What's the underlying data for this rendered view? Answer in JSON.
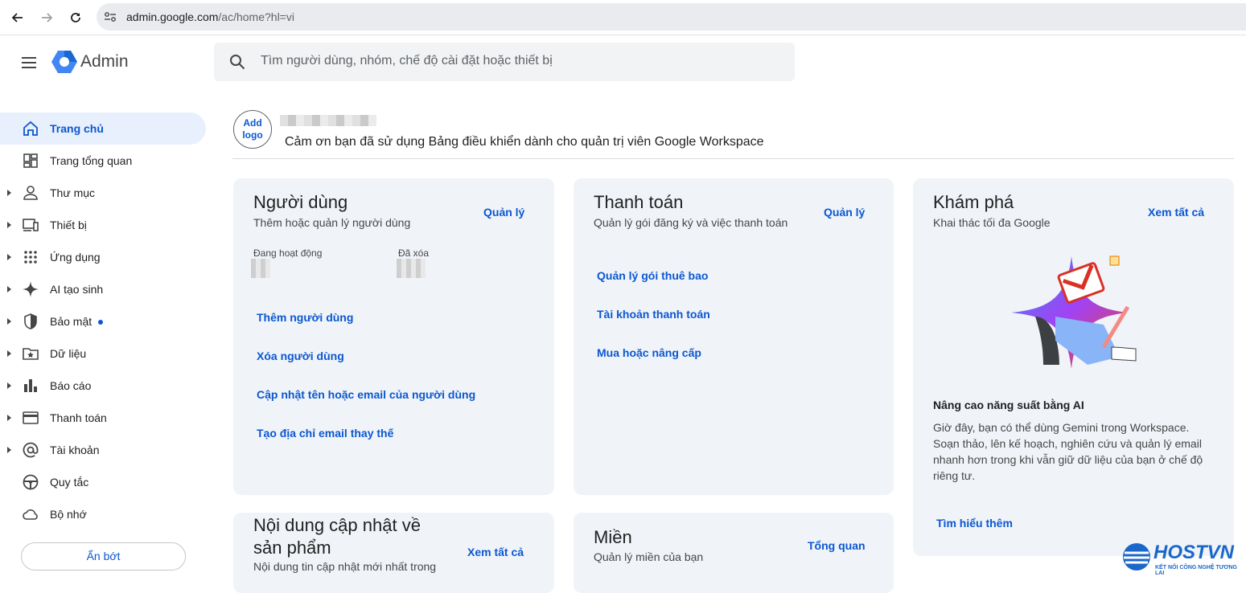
{
  "browser": {
    "url_host": "admin.google.com",
    "url_path": "/ac/home?hl=vi"
  },
  "header": {
    "brand": "Admin",
    "search_placeholder": "Tìm người dùng, nhóm, chế độ cài đặt hoặc thiết bị"
  },
  "sidebar": {
    "items": [
      {
        "label": "Trang chủ",
        "icon": "home-icon",
        "active": true,
        "caret": false
      },
      {
        "label": "Trang tổng quan",
        "icon": "dashboard-icon",
        "caret": false
      },
      {
        "label": "Thư mục",
        "icon": "person-icon",
        "caret": true
      },
      {
        "label": "Thiết bị",
        "icon": "devices-icon",
        "caret": true
      },
      {
        "label": "Ứng dụng",
        "icon": "apps-grid-icon",
        "caret": true
      },
      {
        "label": "AI tạo sinh",
        "icon": "sparkle-icon",
        "caret": true
      },
      {
        "label": "Bảo mật",
        "icon": "shield-icon",
        "caret": true,
        "dot": true
      },
      {
        "label": "Dữ liệu",
        "icon": "folder-star-icon",
        "caret": true
      },
      {
        "label": "Báo cáo",
        "icon": "bar-chart-icon",
        "caret": true
      },
      {
        "label": "Thanh toán",
        "icon": "credit-card-icon",
        "caret": true
      },
      {
        "label": "Tài khoản",
        "icon": "at-sign-icon",
        "caret": true
      },
      {
        "label": "Quy tắc",
        "icon": "steering-wheel-icon",
        "caret": false
      },
      {
        "label": "Bộ nhớ",
        "icon": "cloud-icon",
        "caret": false
      }
    ],
    "collapse_label": "Ẩn bớt"
  },
  "org": {
    "add_logo": "Add logo",
    "welcome": "Cảm ơn bạn đã sử dụng Bảng điều khiển dành cho quản trị viên Google Workspace"
  },
  "cards": {
    "users": {
      "title": "Người dùng",
      "subtitle": "Thêm hoặc quản lý người dùng",
      "action": "Quản lý",
      "active_label": "Đang hoạt động",
      "deleted_label": "Đã xóa",
      "links": [
        "Thêm người dùng",
        "Xóa người dùng",
        "Cập nhật tên hoặc email của người dùng",
        "Tạo địa chỉ email thay thế"
      ]
    },
    "billing": {
      "title": "Thanh toán",
      "subtitle": "Quản lý gói đăng ký và việc thanh toán",
      "action": "Quản lý",
      "links": [
        "Quản lý gói thuê bao",
        "Tài khoản thanh toán",
        "Mua hoặc nâng cấp"
      ]
    },
    "explore": {
      "title": "Khám phá",
      "subtitle": "Khai thác tối đa Google",
      "action": "Xem tất cả",
      "heading": "Nâng cao năng suất bằng AI",
      "body": "Giờ đây, bạn có thể dùng Gemini trong Workspace. Soạn thảo, lên kế hoạch, nghiên cứu và quản lý email nhanh hơn trong khi vẫn giữ dữ liệu của bạn ở chế độ riêng tư.",
      "link": "Tìm hiểu thêm"
    },
    "updates": {
      "title_line1": "Nội dung cập nhật về",
      "title_line2": "sản phẩm",
      "subtitle": "Nội dung tin cập nhật mới nhất trong",
      "action": "Xem tất cả"
    },
    "domains": {
      "title": "Miền",
      "subtitle": "Quản lý miền của bạn",
      "action": "Tổng quan"
    }
  },
  "watermark": {
    "name": "HOSTVN",
    "tagline": "KẾT NỐI CÔNG NGHỆ TƯƠNG LAI"
  },
  "colors": {
    "accent": "#0b57d0",
    "card_bg": "#f0f4f9",
    "active_nav_bg": "#e8effd"
  }
}
